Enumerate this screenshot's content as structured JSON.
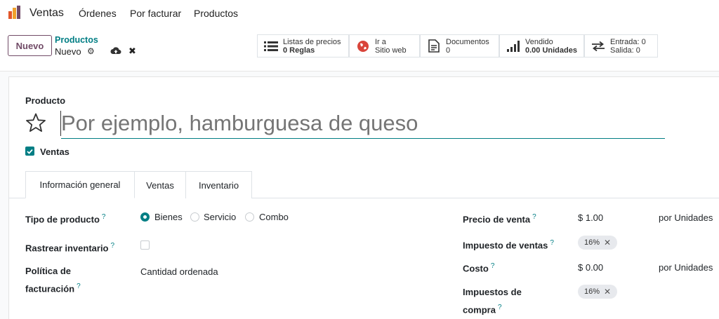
{
  "nav": {
    "app": "Ventas",
    "menu": [
      "Órdenes",
      "Por facturar",
      "Productos"
    ]
  },
  "control": {
    "new_label": "Nuevo",
    "breadcrumb_parent": "Productos",
    "breadcrumb_current": "Nuevo",
    "smart_buttons": [
      {
        "icon": "list-icon",
        "line1": "Listas de precios",
        "line2": "0 Reglas"
      },
      {
        "icon": "globe-icon",
        "line1": "Ir a",
        "line2": "Sitio web"
      },
      {
        "icon": "document-icon",
        "line1": "Documentos",
        "line2": "0"
      },
      {
        "icon": "bar-chart-icon",
        "line1": "Vendido",
        "line2": "0.00 Unidades"
      },
      {
        "icon": "transfer-icon",
        "line1": "Entrada: 0",
        "line2": "Salida: 0"
      }
    ]
  },
  "form": {
    "product_label": "Producto",
    "name_placeholder": "Por ejemplo, hamburguesa de queso",
    "sale_ok_label": "Ventas",
    "tabs": [
      "Información general",
      "Ventas",
      "Inventario"
    ],
    "help_mark": "?",
    "left": {
      "tipo_label": "Tipo de producto",
      "tipo_options": [
        "Bienes",
        "Servicio",
        "Combo"
      ],
      "rastrear_label": "Rastrear inventario",
      "politica_label_1": "Política de",
      "politica_label_2": "facturación",
      "politica_value": "Cantidad ordenada"
    },
    "right": {
      "precio_label": "Precio de venta",
      "precio_value": "$ 1.00",
      "precio_unit": "por Unidades",
      "impuesto_label": "Impuesto de ventas",
      "impuesto_tag": "16%",
      "costo_label": "Costo",
      "costo_value": "$ 0.00",
      "costo_unit": "por Unidades",
      "compra_label_1": "Impuestos de",
      "compra_label_2": "compra",
      "compra_tag": "16%"
    }
  },
  "colors": {
    "brand": "#714B67",
    "accent": "#017e84"
  }
}
